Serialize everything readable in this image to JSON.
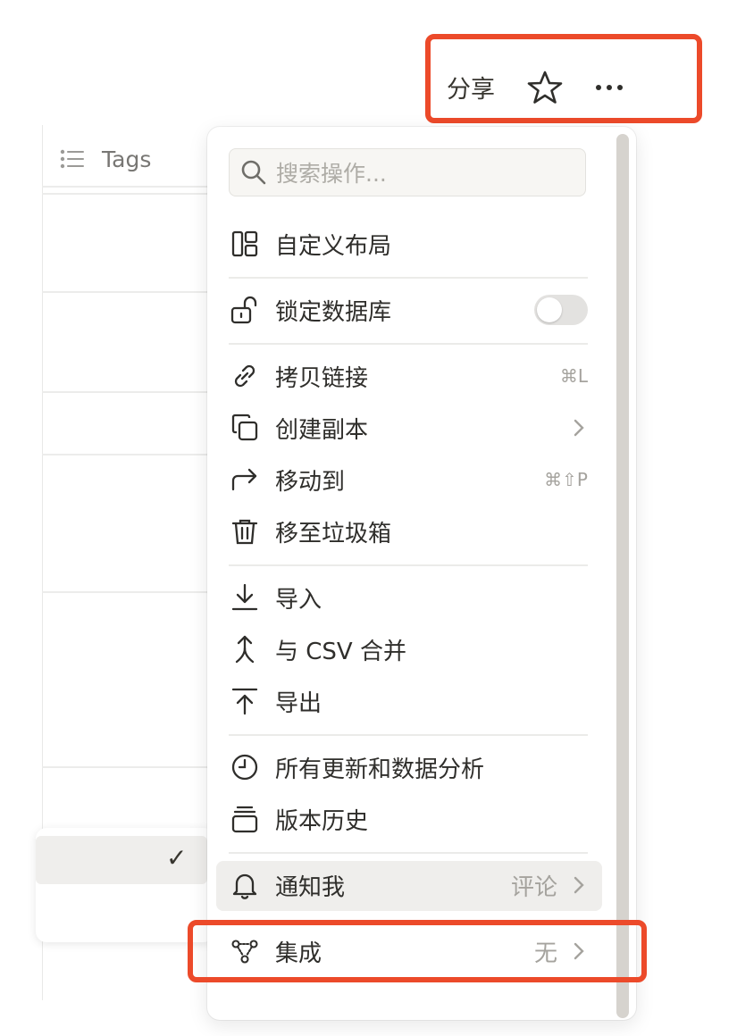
{
  "topbar": {
    "share_label": "分享"
  },
  "table": {
    "column_header": "Tags"
  },
  "menu": {
    "search_placeholder": "搜索操作...",
    "items": {
      "custom_layout": "自定义布局",
      "lock_db": "锁定数据库",
      "copy_link": "拷贝链接",
      "copy_link_shortcut": "⌘L",
      "duplicate": "创建副本",
      "move_to": "移动到",
      "move_to_shortcut": "⌘⇧P",
      "trash": "移至垃圾箱",
      "import": "导入",
      "merge_csv": "与 CSV 合并",
      "export": "导出",
      "updates_analytics": "所有更新和数据分析",
      "version_history": "版本历史",
      "notify_me": "通知我",
      "notify_value": "评论",
      "integrations": "集成",
      "integrations_value": "无"
    },
    "lock_toggle_on": false
  },
  "submenu": {
    "check_mark": "✓"
  },
  "colors": {
    "highlight": "#ec4a2a",
    "text": "#37352f",
    "muted": "#a5a39e"
  }
}
